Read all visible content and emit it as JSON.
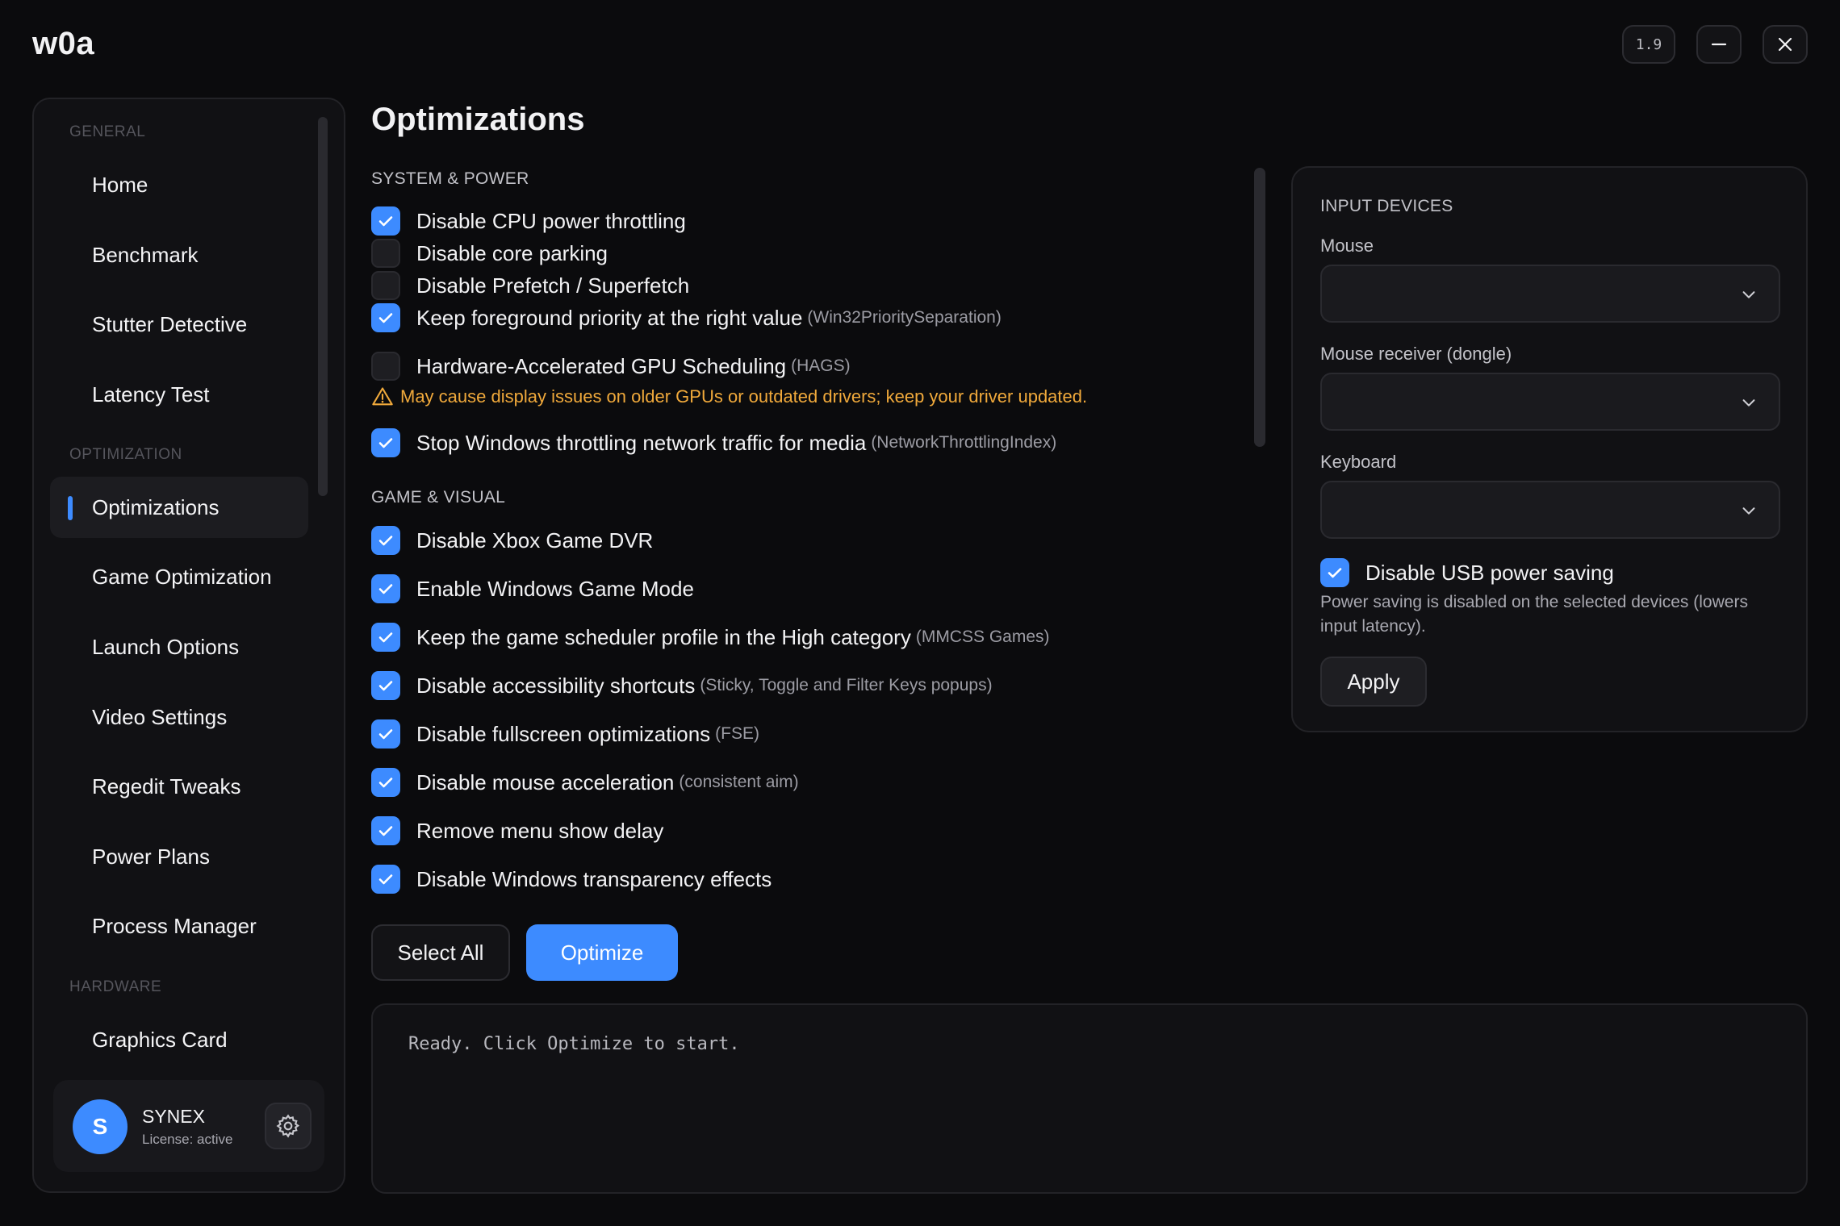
{
  "app": {
    "title": "w0a",
    "version": "1.9"
  },
  "sidebar": {
    "sections": [
      {
        "label": "GENERAL",
        "items": [
          "Home",
          "Benchmark",
          "Stutter Detective",
          "Latency Test"
        ]
      },
      {
        "label": "OPTIMIZATION",
        "items": [
          "Optimizations",
          "Game Optimization",
          "Launch Options",
          "Video Settings",
          "Regedit Tweaks",
          "Power Plans",
          "Process Manager"
        ]
      },
      {
        "label": "HARDWARE",
        "items": [
          "Graphics Card"
        ]
      }
    ],
    "active_item": "Optimizations",
    "user": {
      "initial": "S",
      "name": "SYNEX",
      "license": "License: active"
    }
  },
  "main": {
    "title": "Optimizations",
    "system_power": {
      "label": "SYSTEM & POWER",
      "options": [
        {
          "label": "Disable CPU power throttling",
          "hint": "",
          "checked": true
        },
        {
          "label": "Disable core parking",
          "hint": "",
          "checked": false
        },
        {
          "label": "Disable Prefetch / Superfetch",
          "hint": "",
          "checked": false
        },
        {
          "label": "Keep foreground priority at the right value",
          "hint": "(Win32PrioritySeparation)",
          "checked": true
        },
        {
          "label": "Hardware-Accelerated GPU Scheduling",
          "hint": "(HAGS)",
          "checked": false
        },
        {
          "label": "Stop Windows throttling network traffic for media",
          "hint": "(NetworkThrottlingIndex)",
          "checked": true
        }
      ],
      "warning": "May cause display issues on older GPUs or outdated drivers; keep your driver updated."
    },
    "game_visual": {
      "label": "GAME & VISUAL",
      "options": [
        {
          "label": "Disable Xbox Game DVR",
          "hint": "",
          "checked": true
        },
        {
          "label": "Enable Windows Game Mode",
          "hint": "",
          "checked": true
        },
        {
          "label": "Keep the game scheduler profile in the High category",
          "hint": "(MMCSS Games)",
          "checked": true
        },
        {
          "label": "Disable accessibility shortcuts",
          "hint": "(Sticky, Toggle and Filter Keys popups)",
          "checked": true
        },
        {
          "label": "Disable fullscreen optimizations",
          "hint": "(FSE)",
          "checked": true
        },
        {
          "label": "Disable mouse acceleration",
          "hint": "(consistent aim)",
          "checked": true
        },
        {
          "label": "Remove menu show delay",
          "hint": "",
          "checked": true
        },
        {
          "label": "Disable Windows transparency effects",
          "hint": "",
          "checked": true
        }
      ]
    },
    "buttons": {
      "select_all": "Select All",
      "optimize": "Optimize"
    },
    "log": "Ready. Click Optimize to start."
  },
  "input_devices": {
    "title": "INPUT DEVICES",
    "mouse_label": "Mouse",
    "mouse_value": "",
    "receiver_label": "Mouse receiver (dongle)",
    "receiver_value": "",
    "keyboard_label": "Keyboard",
    "keyboard_value": "",
    "usb_label": "Disable USB power saving",
    "usb_checked": true,
    "usb_desc": "Power saving is disabled on the selected devices (lowers input latency).",
    "apply": "Apply"
  },
  "colors": {
    "accent": "#3d8bff",
    "warning": "#f0a93b",
    "background": "#0b0b0d"
  }
}
